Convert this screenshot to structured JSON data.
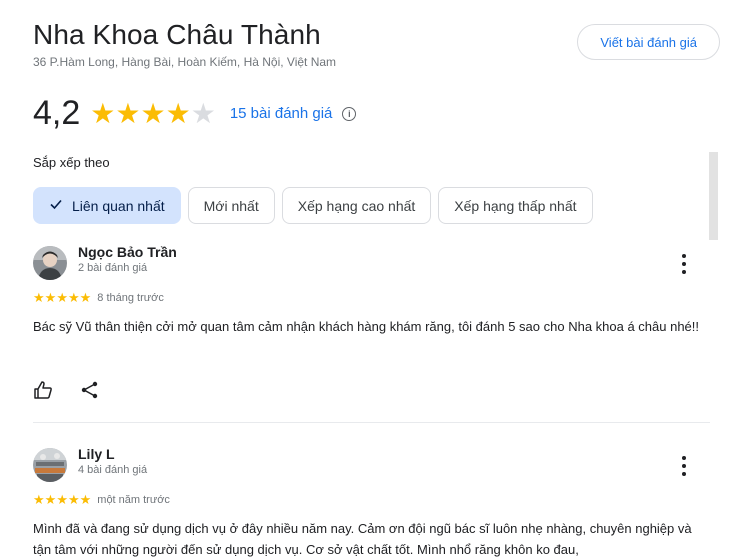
{
  "business": {
    "name": "Nha Khoa Châu Thành",
    "address": "36 P.Hàm Long, Hàng Bài, Hoàn Kiếm, Hà Nội, Việt Nam",
    "write_review_label": "Viết bài đánh giá"
  },
  "summary": {
    "rating": "4,2",
    "stars_filled": 4,
    "stars_total": 5,
    "count_label": "15 bài đánh giá",
    "info_icon": "i"
  },
  "sort": {
    "label": "Sắp xếp theo",
    "options": [
      {
        "label": "Liên quan nhất",
        "selected": true
      },
      {
        "label": "Mới nhất",
        "selected": false
      },
      {
        "label": "Xếp hạng cao nhất",
        "selected": false
      },
      {
        "label": "Xếp hạng thấp nhất",
        "selected": false
      }
    ]
  },
  "reviews": [
    {
      "name": "Ngọc Bảo Trần",
      "meta": "2 bài đánh giá",
      "stars": 5,
      "time": "8 tháng trước",
      "text": "Bác sỹ Vũ thân thiện cởi mở quan tâm cảm nhận khách hàng khám răng, tôi đánh 5 sao cho Nha khoa á châu nhé!!"
    },
    {
      "name": "Lily L",
      "meta": "4 bài đánh giá",
      "stars": 5,
      "time": "một năm trước",
      "text": "Mình đã và đang sử dụng dịch vụ ở đây nhiều năm nay. Cảm ơn đội ngũ bác sĩ luôn nhẹ nhàng, chuyên nghiệp và tận tâm với những người đến sử dụng dịch vụ. Cơ sở vật chất tốt. Mình nhổ răng khôn ko đau,"
    }
  ],
  "colors": {
    "star": "#fbbc04",
    "star_empty": "#dadce0",
    "link": "#1a73e8",
    "chip_selected": "#d3e3fd"
  },
  "icons": {
    "check": "check-icon",
    "more": "more-vert-icon",
    "like": "thumb-up-icon",
    "share": "share-icon",
    "info": "info-icon"
  }
}
